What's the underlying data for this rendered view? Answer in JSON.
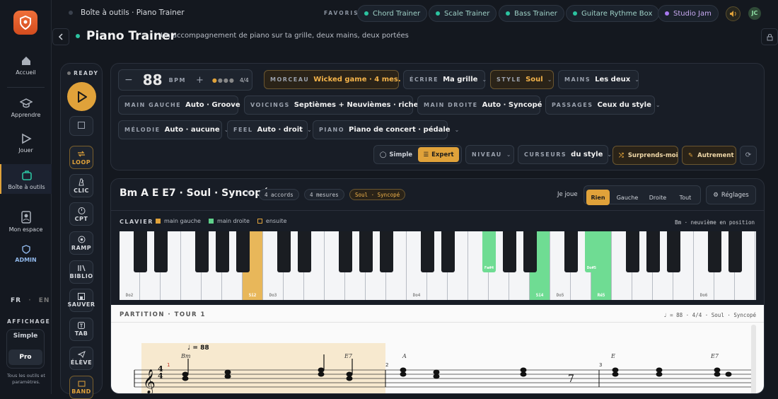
{
  "nav": {
    "items": [
      {
        "label": "Accueil"
      },
      {
        "label": "Apprendre"
      },
      {
        "label": "Jouer"
      },
      {
        "label": "Boîte à outils"
      },
      {
        "label": "Mon espace"
      },
      {
        "label": "ADMIN"
      }
    ],
    "lang": {
      "fr": "FR",
      "sep": "·",
      "en": "EN"
    },
    "display_title": "AFFICHAGE",
    "display_simple": "Simple",
    "display_pro": "Pro",
    "display_note": "Tous les outils et paramètres."
  },
  "breadcrumb": "Boîte à outils · Piano Trainer",
  "favoris": "FAVORIS",
  "favs": [
    "Chord Trainer",
    "Scale Trainer",
    "Bass Trainer",
    "Guitare Rythme Box",
    "Studio Jam"
  ],
  "user_initials": "JC",
  "page": {
    "title": "Piano Trainer",
    "subtitle": "Un accompagnement de piano sur ta grille, deux mains, deux portées"
  },
  "transport": {
    "ready": "READY",
    "loop": "LOOP",
    "clic": "CLIC",
    "cpt": "CPT",
    "ramp": "RAMP",
    "biblio": "BIBLIO",
    "sauver": "SAUVER",
    "tab": "TAB",
    "eleve": "ÉLÈVE",
    "band": "BAND"
  },
  "controls": {
    "bpm": "88",
    "bpm_unit": "BPM",
    "meter": "4/4",
    "morceau_k": "MORCEAU",
    "morceau_v": "Wicked game · 4 mes.",
    "ecrire_k": "ÉCRIRE",
    "ecrire_v": "Ma grille",
    "style_k": "STYLE",
    "style_v": "Soul",
    "mains_k": "MAINS",
    "mains_v": "Les deux",
    "mg_k": "MAIN GAUCHE",
    "mg_v": "Auto · Groove",
    "voic_k": "VOICINGS",
    "voic_v": "Septièmes + Neuvièmes · riches",
    "md_k": "MAIN DROITE",
    "md_v": "Auto · Syncopé",
    "pass_k": "PASSAGES",
    "pass_v": "Ceux du style",
    "mel_k": "MÉLODIE",
    "mel_v": "Auto · aucune",
    "feel_k": "FEEL",
    "feel_v": "Auto · droit",
    "piano_k": "PIANO",
    "piano_v": "Piano de concert · pédale",
    "simple": "Simple",
    "expert": "Expert",
    "niveau": "NIVEAU",
    "curseurs_k": "CURSEURS",
    "curseurs_v": "du style",
    "surprends": "Surprends-moi",
    "autrement": "Autrement"
  },
  "viewer": {
    "title": "Bm A E E7 · Soul · Syncopé",
    "b1": "4 accords",
    "b2": "4 mesures",
    "b3": "Soul · Syncopé",
    "je_joue": "Je joue",
    "tabs": [
      "Rien",
      "Gauche",
      "Droite",
      "Tout"
    ],
    "reglages": "Réglages",
    "clavier": "CLAVIER",
    "leg_g": "main gauche",
    "leg_d": "main droite",
    "leg_e": "ensuite",
    "chord_info": "Bm · neuvième en position",
    "key_labels": {
      "do2": "Do2",
      "si2": "Si2",
      "do3": "Do3",
      "do4": "Do4",
      "fa4": "Fa#4",
      "do5b": "Do#5",
      "si4": "Si4",
      "do5": "Do5",
      "re5": "Ré5",
      "do6": "Do6"
    },
    "partition": "PARTITION · TOUR 1",
    "part_info": "♩ = 88 · 4/4 · Soul · Syncopé",
    "score": {
      "tempo": "= 88",
      "ts_top": "4",
      "ts_bot": "4",
      "chords": [
        "Bm",
        "E7",
        "A",
        "E",
        "E7"
      ],
      "measures": [
        "1",
        "2",
        "3"
      ]
    }
  },
  "colors": {
    "accent": "#e0a23a",
    "left": "#e0a23a",
    "right": "#5fd08a",
    "teal": "#2cc3a0"
  }
}
